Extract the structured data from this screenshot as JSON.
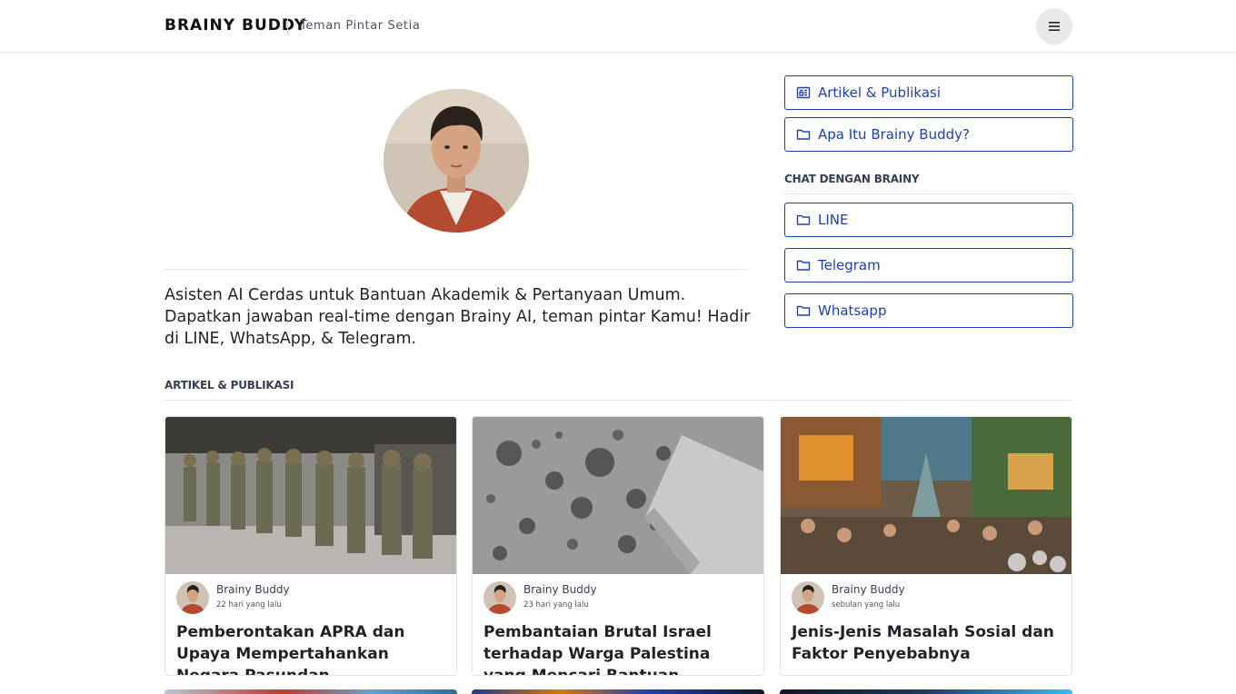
{
  "header": {
    "brand": "BRAINY BUDDY",
    "tagline": "Teman Pintar Setia",
    "menu_icon": "hamburger-icon"
  },
  "profile": {
    "bio": "Asisten AI Cerdas untuk Bantuan Akademik & Pertanyaan Umum. Dapatkan jawaban real-time dengan Brainy AI, teman pintar Kamu! Hadir di LINE, WhatsApp, & Telegram."
  },
  "sidebar": {
    "links": [
      {
        "label": "Artikel & Publikasi",
        "icon": "newspaper-icon"
      },
      {
        "label": "Apa Itu Brainy Buddy?",
        "icon": "folder-icon"
      }
    ],
    "chat_heading": "CHAT DENGAN BRAINY",
    "chat_links": [
      {
        "label": "LINE",
        "icon": "folder-icon"
      },
      {
        "label": "Telegram",
        "icon": "folder-icon"
      },
      {
        "label": "Whatsapp",
        "icon": "folder-icon"
      }
    ]
  },
  "articles": {
    "heading": "ARTIKEL & PUBLIKASI",
    "items": [
      {
        "author": "Brainy Buddy",
        "time": "22 hari yang lalu",
        "title": "Pemberontakan APRA dan Upaya Mempertahankan Negara Pasundan"
      },
      {
        "author": "Brainy Buddy",
        "time": "23 hari yang lalu",
        "title": "Pembantaian Brutal Israel terhadap Warga Palestina yang Mencari Bantuan"
      },
      {
        "author": "Brainy Buddy",
        "time": "sebulan yang lalu",
        "title": "Jenis-Jenis Masalah Sosial dan Faktor Penyebabnya"
      }
    ]
  },
  "colors": {
    "accent": "#1e40af",
    "border": "#e5e7eb",
    "text": "#1f2328"
  }
}
